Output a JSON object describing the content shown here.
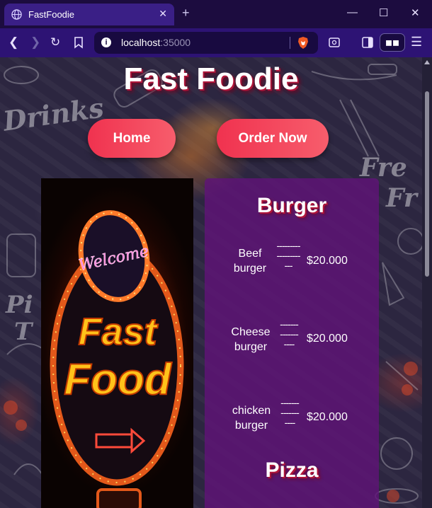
{
  "browser": {
    "tab_title": "FastFoodie",
    "url_host": "localhost",
    "url_port": ":35000"
  },
  "page": {
    "site_title": "Fast Foodie",
    "nav": {
      "home_label": "Home",
      "order_label": "Order Now"
    },
    "image_text": {
      "welcome": "Welcome",
      "fast": "Fast",
      "food": "Food"
    },
    "menu": {
      "burger_title": "Burger",
      "pizza_title": "Pizza",
      "items": [
        {
          "name_line1": "Beef",
          "name_line2": "burger",
          "dots": [
            "---------",
            "---------",
            "---"
          ],
          "price": "$20.000"
        },
        {
          "name_line1": "Cheese",
          "name_line2": "burger",
          "dots": [
            "-------",
            "-------",
            "----"
          ],
          "price": "$20.000"
        },
        {
          "name_line1": "chicken",
          "name_line2": "burger",
          "dots": [
            "-------",
            "-------",
            "----"
          ],
          "price": "$20.000"
        }
      ]
    },
    "background_words": [
      "Drinks",
      "Fre",
      "Fr",
      "Pi",
      "T"
    ]
  },
  "colors": {
    "tabbar": "#1c0c3f",
    "toolbar": "#2d1374",
    "accent_pill": "#f0324f",
    "card": "#5f1478"
  }
}
